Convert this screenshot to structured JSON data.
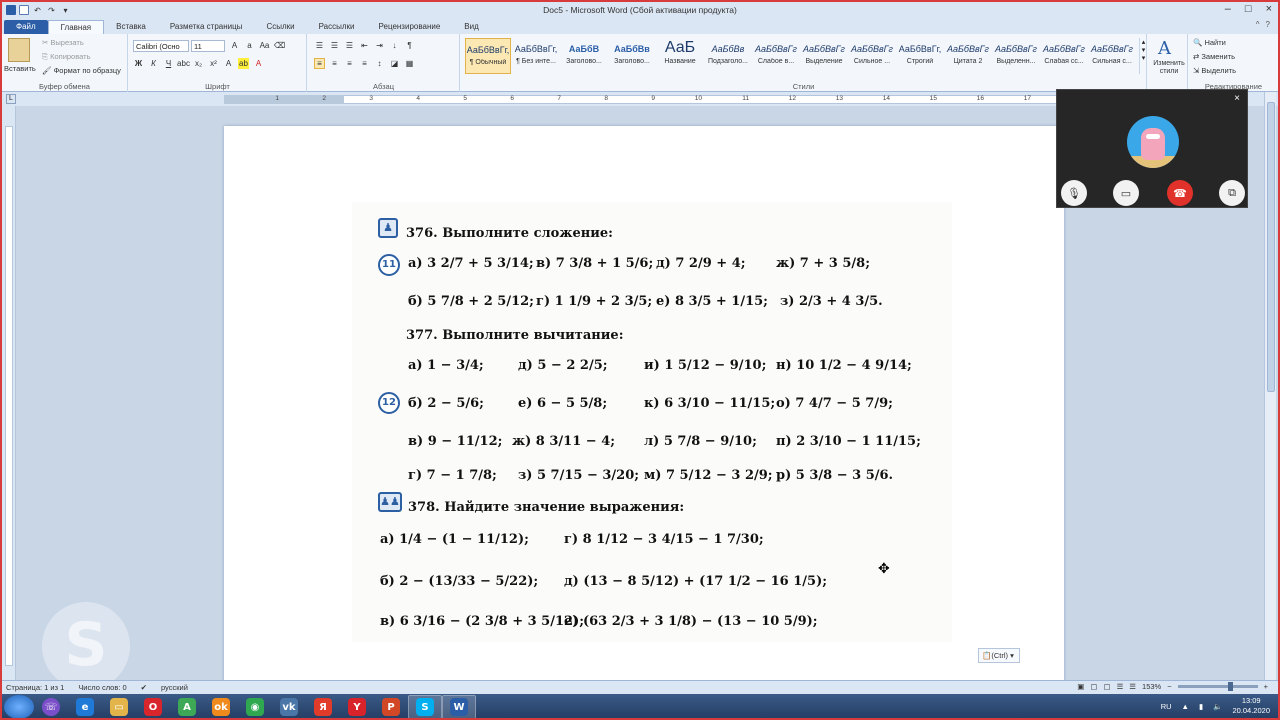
{
  "window": {
    "title": "Doc5 - Microsoft Word (Сбой активации продукта)",
    "buttons": [
      "–",
      "□",
      "×"
    ]
  },
  "tabs": [
    "Файл",
    "Главная",
    "Вставка",
    "Разметка страницы",
    "Ссылки",
    "Рассылки",
    "Рецензирование",
    "Вид"
  ],
  "ribbon": {
    "clipboard": {
      "paste": "Вставить",
      "cut": "Вырезать",
      "copy": "Копировать",
      "format": "Формат по образцу",
      "label": "Буфер обмена"
    },
    "font": {
      "name": "Calibri (Осно",
      "size": "11",
      "label": "Шрифт"
    },
    "paragraph": {
      "label": "Абзац"
    },
    "styles": {
      "label": "Стили",
      "items": [
        {
          "preview": "АаБбВвГг,",
          "name": "¶ Обычный"
        },
        {
          "preview": "АаБбВвГг,",
          "name": "¶ Без инте..."
        },
        {
          "preview": "АаБбВ",
          "name": "Заголово..."
        },
        {
          "preview": "АаБбВв",
          "name": "Заголово..."
        },
        {
          "preview": "АаБ",
          "name": "Название"
        },
        {
          "preview": "АаБбВв",
          "name": "Подзаголо..."
        },
        {
          "preview": "АаБбВвГг",
          "name": "Слабое в..."
        },
        {
          "preview": "АаБбВвГг",
          "name": "Выделение"
        },
        {
          "preview": "АаБбВвГг",
          "name": "Сильное ..."
        },
        {
          "preview": "АаБбВвГг,",
          "name": "Строгий"
        },
        {
          "preview": "АаБбВвГг",
          "name": "Цитата 2"
        },
        {
          "preview": "АаБбВвГг",
          "name": "Выделенн..."
        },
        {
          "preview": "АаБбВвГг",
          "name": "Слабая сс..."
        },
        {
          "preview": "АаБбВвГг",
          "name": "Сильная с..."
        }
      ],
      "change": "Изменить стили"
    },
    "editing": {
      "find": "Найти",
      "replace": "Заменить",
      "select": "Выделить",
      "label": "Редактирование"
    }
  },
  "ruler_numbers": [
    "1",
    "2",
    "3",
    "4",
    "5",
    "6",
    "7",
    "8",
    "9",
    "10",
    "11",
    "12",
    "13",
    "14",
    "15",
    "16",
    "17"
  ],
  "scan": {
    "ex376": {
      "title": "376. Выполните сложение:",
      "badge": "11"
    },
    "ex376_rows": [
      [
        "а) 3 2/7 + 5 3/14;",
        "в) 7 3/8 + 1 5/6;",
        "д) 7 2/9 + 4;",
        "ж) 7 + 3 5/8;"
      ],
      [
        "б) 5 7/8 + 2 5/12;",
        "г) 1 1/9 + 2 3/5;",
        "е) 8 3/5 + 1/15;",
        "з) 2/3 + 4 3/5."
      ]
    ],
    "ex377": {
      "title": "377. Выполните вычитание:",
      "badge": "12"
    },
    "ex377_rows": [
      [
        "а) 1 − 3/4;",
        "д) 5 − 2 2/5;",
        "и) 1 5/12 − 9/10;",
        "н) 10 1/2 − 4 9/14;"
      ],
      [
        "б) 2 − 5/6;",
        "е) 6 − 5 5/8;",
        "к) 6 3/10 − 11/15;",
        "о) 7 4/7 − 5 7/9;"
      ],
      [
        "в) 9 − 11/12;",
        "ж) 8 3/11 − 4;",
        "л) 5 7/8 − 9/10;",
        "п) 2 3/10 − 1 11/15;"
      ],
      [
        "г) 7 − 1 7/8;",
        "з) 5 7/15 − 3/20;",
        "м) 7 5/12 − 3 2/9;",
        "р) 5 3/8 − 3 5/6."
      ]
    ],
    "ex378": {
      "title": "378. Найдите значение выражения:"
    },
    "ex378_rows": [
      [
        "а) 1/4 − (1 − 11/12);",
        "г) 8 1/12 − 3 4/15 − 1 7/30;"
      ],
      [
        "б) 2 − (13/33 − 5/22);",
        "д) (13 − 8 5/12) + (17 1/2 − 16 1/5);"
      ],
      [
        "в) 6 3/16 − (2 3/8 + 3 5/12);",
        "е) (63 2/3 + 3 1/8) − (13 − 10 5/9);"
      ]
    ]
  },
  "paste_options": "(Ctrl)",
  "call": {
    "close": "×"
  },
  "status": {
    "page": "Страница: 1 из 1",
    "words": "Число слов: 0",
    "lang": "русский",
    "zoom": "153%"
  },
  "tray": {
    "lang": "RU",
    "time": "13:09",
    "date": "20.04.2020"
  },
  "taskbar": [
    {
      "name": "ie",
      "glyph": "e",
      "color": "#1e7ad6"
    },
    {
      "name": "explorer",
      "glyph": "▭",
      "color": "#e3b44a"
    },
    {
      "name": "opera",
      "glyph": "O",
      "color": "#d9262c"
    },
    {
      "name": "android-studio",
      "glyph": "A",
      "color": "#3da855"
    },
    {
      "name": "odnoklassniki",
      "glyph": "ok",
      "color": "#f08a1d"
    },
    {
      "name": "chrome",
      "glyph": "◉",
      "color": "#2fa84f"
    },
    {
      "name": "vk",
      "glyph": "vk",
      "color": "#4b76a8"
    },
    {
      "name": "yandex",
      "glyph": "Я",
      "color": "#e23b2a"
    },
    {
      "name": "yandex-browser",
      "glyph": "Y",
      "color": "#d8232a"
    },
    {
      "name": "powerpoint",
      "glyph": "P",
      "color": "#d24726"
    },
    {
      "name": "skype",
      "glyph": "S",
      "color": "#00aff0"
    },
    {
      "name": "word",
      "glyph": "W",
      "color": "#2b5ea7"
    }
  ]
}
